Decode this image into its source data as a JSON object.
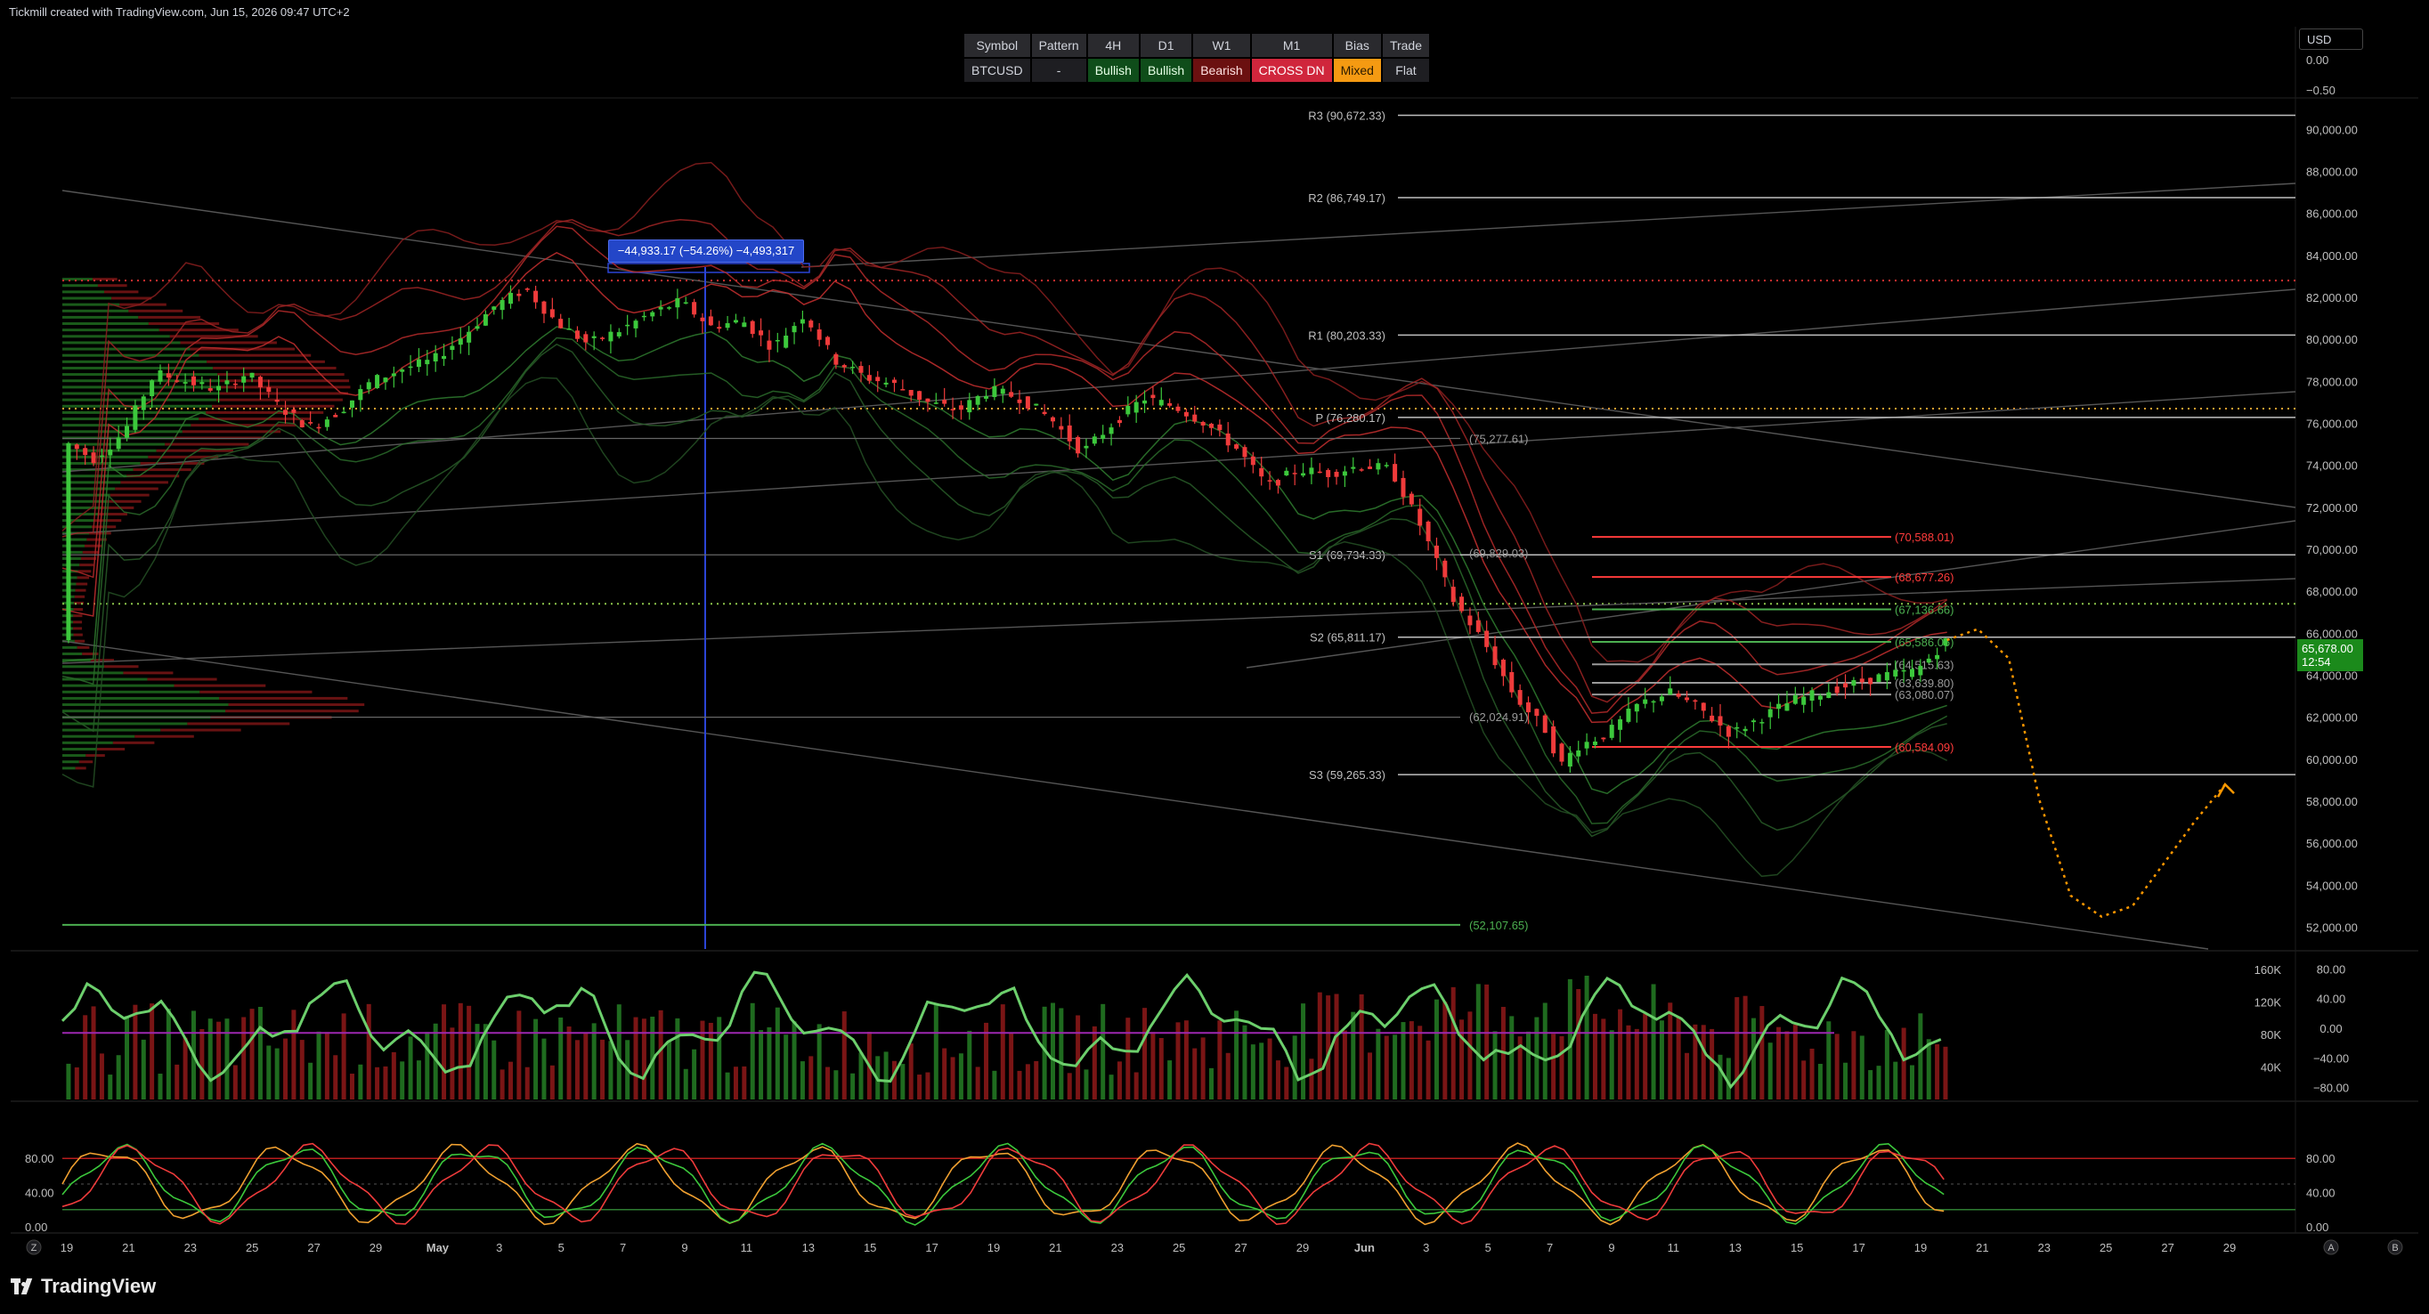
{
  "header": {
    "text": "Tickmill created with TradingView.com, Jun 15, 2026 09:47 UTC+2"
  },
  "branding": {
    "logo_text": "TradingView"
  },
  "currency": "USD",
  "status_table": {
    "headers": [
      "Symbol",
      "Pattern",
      "4H",
      "D1",
      "W1",
      "M1",
      "Bias",
      "Trade"
    ],
    "values": [
      "BTCUSD",
      "-",
      "Bullish",
      "Bullish",
      "Bearish",
      "CROSS DN",
      "Mixed",
      "Flat"
    ]
  },
  "measure_label": "−44,933.17 (−54.26%) −4,493,317",
  "current_price": {
    "price": "65,678.00",
    "countdown": "12:54"
  },
  "colors": {
    "bull": "#26a69a",
    "bull_green": "#3cc83c",
    "bear": "#ef3b3b",
    "pivot_line": "#bfbfbf",
    "level_red": "#ff3b3b",
    "level_green": "#4caf50",
    "projection": "#ff9800",
    "measure": "#2346c8"
  },
  "chart_data": [
    {
      "type": "line",
      "name": "price",
      "ylim": [
        51000,
        91500
      ],
      "y_ticks": [
        52000,
        54000,
        56000,
        58000,
        60000,
        62000,
        64000,
        66000,
        68000,
        70000,
        72000,
        74000,
        76000,
        78000,
        80000,
        82000,
        84000,
        86000,
        88000,
        90000
      ],
      "y_tick_labels": [
        "52,000.00",
        "54,000.00",
        "56,000.00",
        "58,000.00",
        "60,000.00",
        "62,000.00",
        "64,000.00",
        "66,000.00",
        "68,000.00",
        "70,000.00",
        "72,000.00",
        "74,000.00",
        "76,000.00",
        "78,000.00",
        "80,000.00",
        "82,000.00",
        "84,000.00",
        "86,000.00",
        "88,000.00",
        "90,000.00"
      ],
      "x_labels": [
        "19",
        "21",
        "23",
        "25",
        "27",
        "29",
        "May",
        "3",
        "5",
        "7",
        "9",
        "11",
        "13",
        "15",
        "17",
        "19",
        "21",
        "23",
        "25",
        "27",
        "29",
        "Jun",
        "3",
        "5",
        "7",
        "9",
        "11",
        "13",
        "15",
        "17",
        "19",
        "21",
        "23",
        "25",
        "27",
        "29"
      ],
      "x_range": [
        0,
        71
      ],
      "pivots": [
        {
          "label": "R3 (90,672.33)",
          "value": 90672.33
        },
        {
          "label": "R2 (86,749.17)",
          "value": 86749.17
        },
        {
          "label": "R1 (80,203.33)",
          "value": 80203.33
        },
        {
          "label": "P (76,280.17)",
          "value": 76280.17
        },
        {
          "label": "S1 (69,734.33)",
          "value": 69734.33
        },
        {
          "label": "S2 (65,811.17)",
          "value": 65811.17
        },
        {
          "label": "S3 (59,265.33)",
          "value": 59265.33
        }
      ],
      "levels": [
        {
          "label": "(70,588.01)",
          "value": 70588.01,
          "color": "red"
        },
        {
          "label": "(68,677.26)",
          "value": 68677.26,
          "color": "red"
        },
        {
          "label": "(67,136.66)",
          "value": 67136.66,
          "color": "green"
        },
        {
          "label": "(65,586.05)",
          "value": 65586.05,
          "color": "green"
        },
        {
          "label": "(64,515.63)",
          "value": 64515.63,
          "color": "gray"
        },
        {
          "label": "(63,639.80)",
          "value": 63639.8,
          "color": "gray"
        },
        {
          "label": "(63,080.07)",
          "value": 63080.07,
          "color": "gray"
        },
        {
          "label": "(60,584.09)",
          "value": 60584.09,
          "color": "red"
        },
        {
          "label": "(75,277.61)",
          "value": 75277.61,
          "color": "gray"
        },
        {
          "label": "(69,829.03)",
          "value": 69829.03,
          "color": "gray"
        },
        {
          "label": "(62,024.91)",
          "value": 62024.91,
          "color": "gray"
        },
        {
          "label": "(52,107.65)",
          "value": 52107.65,
          "color": "green"
        }
      ],
      "close_path": [
        [
          0,
          75200
        ],
        [
          1,
          74300
        ],
        [
          1.5,
          74900
        ],
        [
          2,
          75600
        ],
        [
          3,
          78400
        ],
        [
          4,
          78000
        ],
        [
          5,
          77600
        ],
        [
          6,
          78400
        ],
        [
          7,
          76800
        ],
        [
          8,
          75800
        ],
        [
          9,
          76600
        ],
        [
          10,
          78000
        ],
        [
          11,
          78600
        ],
        [
          12,
          79000
        ],
        [
          13,
          80200
        ],
        [
          14,
          81600
        ],
        [
          15,
          82400
        ],
        [
          16,
          80800
        ],
        [
          17,
          79800
        ],
        [
          18,
          80400
        ],
        [
          19,
          81200
        ],
        [
          20,
          81800
        ],
        [
          21,
          80600
        ],
        [
          22,
          80900
        ],
        [
          23,
          79600
        ],
        [
          24,
          81200
        ],
        [
          25,
          79000
        ],
        [
          26,
          78200
        ],
        [
          27,
          77800
        ],
        [
          28,
          77000
        ],
        [
          29,
          76600
        ],
        [
          30,
          77600
        ],
        [
          31,
          77200
        ],
        [
          32,
          76200
        ],
        [
          33,
          74600
        ],
        [
          34,
          76000
        ],
        [
          35,
          77200
        ],
        [
          36,
          76800
        ],
        [
          37,
          76000
        ],
        [
          38,
          74800
        ],
        [
          39,
          73000
        ],
        [
          40,
          73800
        ],
        [
          41,
          73600
        ],
        [
          42,
          74000
        ],
        [
          43,
          73800
        ],
        [
          44,
          71000
        ],
        [
          45,
          67600
        ],
        [
          46,
          65600
        ],
        [
          47,
          63000
        ],
        [
          48,
          61400
        ],
        [
          48.5,
          59700
        ],
        [
          49,
          60600
        ],
        [
          50,
          61200
        ],
        [
          51,
          62600
        ],
        [
          52,
          63200
        ],
        [
          53,
          62400
        ],
        [
          54,
          61200
        ],
        [
          55,
          62000
        ],
        [
          56,
          62800
        ],
        [
          57,
          63200
        ],
        [
          58,
          63600
        ],
        [
          59,
          64000
        ],
        [
          60,
          64200
        ],
        [
          61,
          65678
        ]
      ],
      "projection_path": [
        [
          61,
          65678
        ],
        [
          62,
          66200
        ],
        [
          63,
          64800
        ],
        [
          64,
          58000
        ],
        [
          65,
          53500
        ],
        [
          66,
          52500
        ],
        [
          67,
          53000
        ],
        [
          68,
          55000
        ],
        [
          69,
          57000
        ],
        [
          70,
          58800
        ]
      ],
      "range_x": [
        0,
        71
      ]
    },
    {
      "type": "bar",
      "name": "volume",
      "ylim": [
        0,
        170000
      ],
      "y_tick_labels": [
        "160K",
        "120K",
        "80K",
        "40K"
      ],
      "y_ticks": [
        160000,
        120000,
        80000,
        40000
      ],
      "osc_tick_labels": [
        "80.00",
        "40.00",
        "0.00",
        "−40.00",
        "−80.00"
      ],
      "osc_ticks": [
        80,
        40,
        0,
        -40,
        -80
      ]
    },
    {
      "type": "line",
      "name": "stochastic",
      "ylim": [
        0,
        100
      ],
      "y_tick_labels": [
        "80.00",
        "40.00",
        "0.00"
      ],
      "y_ticks": [
        80,
        40,
        0
      ],
      "left_tick_labels": [
        "80.00",
        "40.00",
        "0.00"
      ]
    }
  ],
  "price_scale_top": [
    "0.00",
    "−0.50"
  ],
  "axis_buttons": {
    "left": "Z",
    "right_a": "A",
    "right_b": "B"
  }
}
